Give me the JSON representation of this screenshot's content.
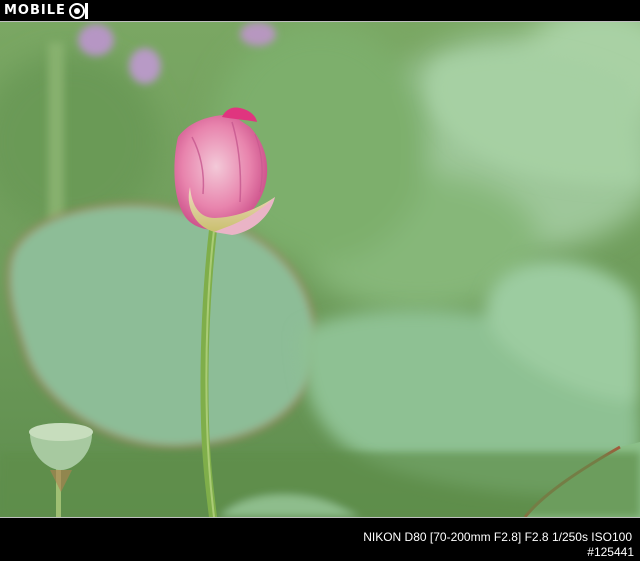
{
  "header": {
    "logo_text": "MOBILE",
    "logo_mark_icon": "mobile01-logo-icon"
  },
  "photo": {
    "subject": "lotus-bud-photo",
    "colors": {
      "background_green": "#6f9a5e",
      "leaf_green": "#8fbf98",
      "bud_pink": "#e0609a",
      "stem_green": "#7fae4a"
    }
  },
  "footer": {
    "exif": "NIKON D80 [70-200mm F2.8] F2.8 1/250s ISO100",
    "photo_id": "#125441"
  }
}
